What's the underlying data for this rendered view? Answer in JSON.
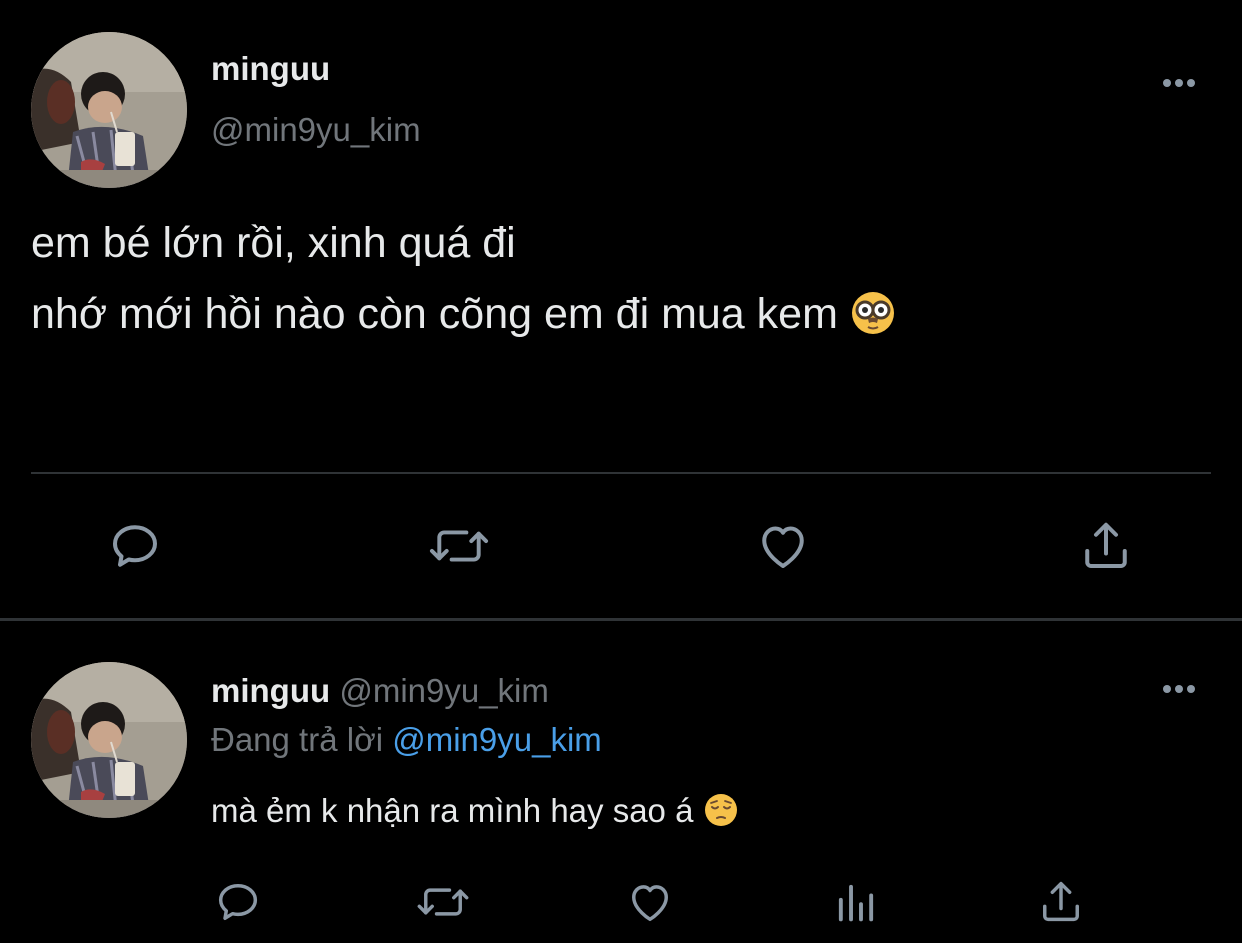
{
  "colors": {
    "background": "#000000",
    "primary_text": "#e7e9ea",
    "secondary_text": "#71767b",
    "mention": "#4a9fe8",
    "divider": "#2f3336",
    "icon": "#8b98a5"
  },
  "main_tweet": {
    "display_name": "minguu",
    "handle": "@min9yu_kim",
    "text_lines": [
      "em bé lớn rồi, xinh quá đi",
      "nhớ mới hồi nào còn cõng em đi mua kem"
    ],
    "emoji": "nerd-disguise-face",
    "more_icon": "more-horizontal-icon",
    "actions": [
      "reply-icon",
      "retweet-icon",
      "like-icon",
      "share-icon"
    ]
  },
  "reply_tweet": {
    "display_name": "minguu",
    "handle": "@min9yu_kim",
    "replying_to_prefix": "Đang trả lời",
    "replying_to_handle": "@min9yu_kim",
    "text": "mà ẻm k nhận ra mình hay sao á",
    "emoji": "pensive-face",
    "more_icon": "more-horizontal-icon",
    "actions": [
      "reply-icon",
      "retweet-icon",
      "like-icon",
      "analytics-icon",
      "share-icon"
    ]
  }
}
